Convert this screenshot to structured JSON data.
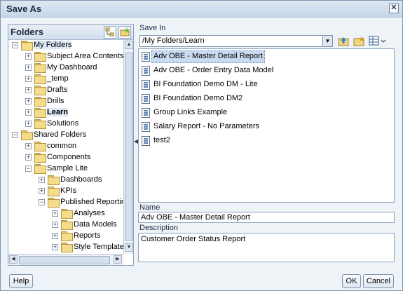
{
  "dialog": {
    "title": "Save As",
    "close_label": "✕"
  },
  "folders": {
    "header": "Folders",
    "tree": [
      {
        "label": "My Folders",
        "level": 0,
        "expanded": true,
        "selected": true,
        "bold": false
      },
      {
        "label": "Subject Area Contents",
        "level": 1,
        "expanded": false
      },
      {
        "label": "My Dashboard",
        "level": 1,
        "expanded": false,
        "icon": "dashboard"
      },
      {
        "label": "_temp",
        "level": 1,
        "expanded": false
      },
      {
        "label": "Drafts",
        "level": 1,
        "expanded": false
      },
      {
        "label": "Drills",
        "level": 1,
        "expanded": false
      },
      {
        "label": "Learn",
        "level": 1,
        "expanded": false,
        "bold": true,
        "selected": true
      },
      {
        "label": "Solutions",
        "level": 1,
        "expanded": false
      },
      {
        "label": "Shared Folders",
        "level": 0,
        "expanded": true
      },
      {
        "label": "common",
        "level": 1,
        "expanded": false
      },
      {
        "label": "Components",
        "level": 1,
        "expanded": false
      },
      {
        "label": "Sample Lite",
        "level": 1,
        "expanded": true
      },
      {
        "label": "Dashboards",
        "level": 2,
        "expanded": false,
        "icon": "dashboard"
      },
      {
        "label": "KPIs",
        "level": 2,
        "expanded": false
      },
      {
        "label": "Published Reporting",
        "level": 2,
        "expanded": true
      },
      {
        "label": "Analyses",
        "level": 3,
        "expanded": false
      },
      {
        "label": "Data Models",
        "level": 3,
        "expanded": false
      },
      {
        "label": "Reports",
        "level": 3,
        "expanded": false
      },
      {
        "label": "Style Templates",
        "level": 3,
        "expanded": false
      }
    ]
  },
  "save_in": {
    "label": "Save In",
    "path": "/My Folders/Learn",
    "items": [
      {
        "label": "Adv OBE - Master Detail Report",
        "selected": true,
        "icon": "report"
      },
      {
        "label": "Adv OBE - Order Entry Data Model",
        "icon": "datamodel"
      },
      {
        "label": "BI Foundation Demo DM - Lite",
        "icon": "datamodel"
      },
      {
        "label": "BI Foundation Demo DM2",
        "icon": "datamodel"
      },
      {
        "label": "Group Links Example",
        "icon": "datamodel"
      },
      {
        "label": "Salary Report - No Parameters",
        "icon": "report"
      },
      {
        "label": "test2",
        "icon": "report"
      }
    ]
  },
  "name": {
    "label": "Name",
    "value": "Adv OBE - Master Detail Report"
  },
  "description": {
    "label": "Description",
    "value": "Customer Order Status Report"
  },
  "buttons": {
    "help": "Help",
    "ok": "OK",
    "cancel": "Cancel"
  }
}
